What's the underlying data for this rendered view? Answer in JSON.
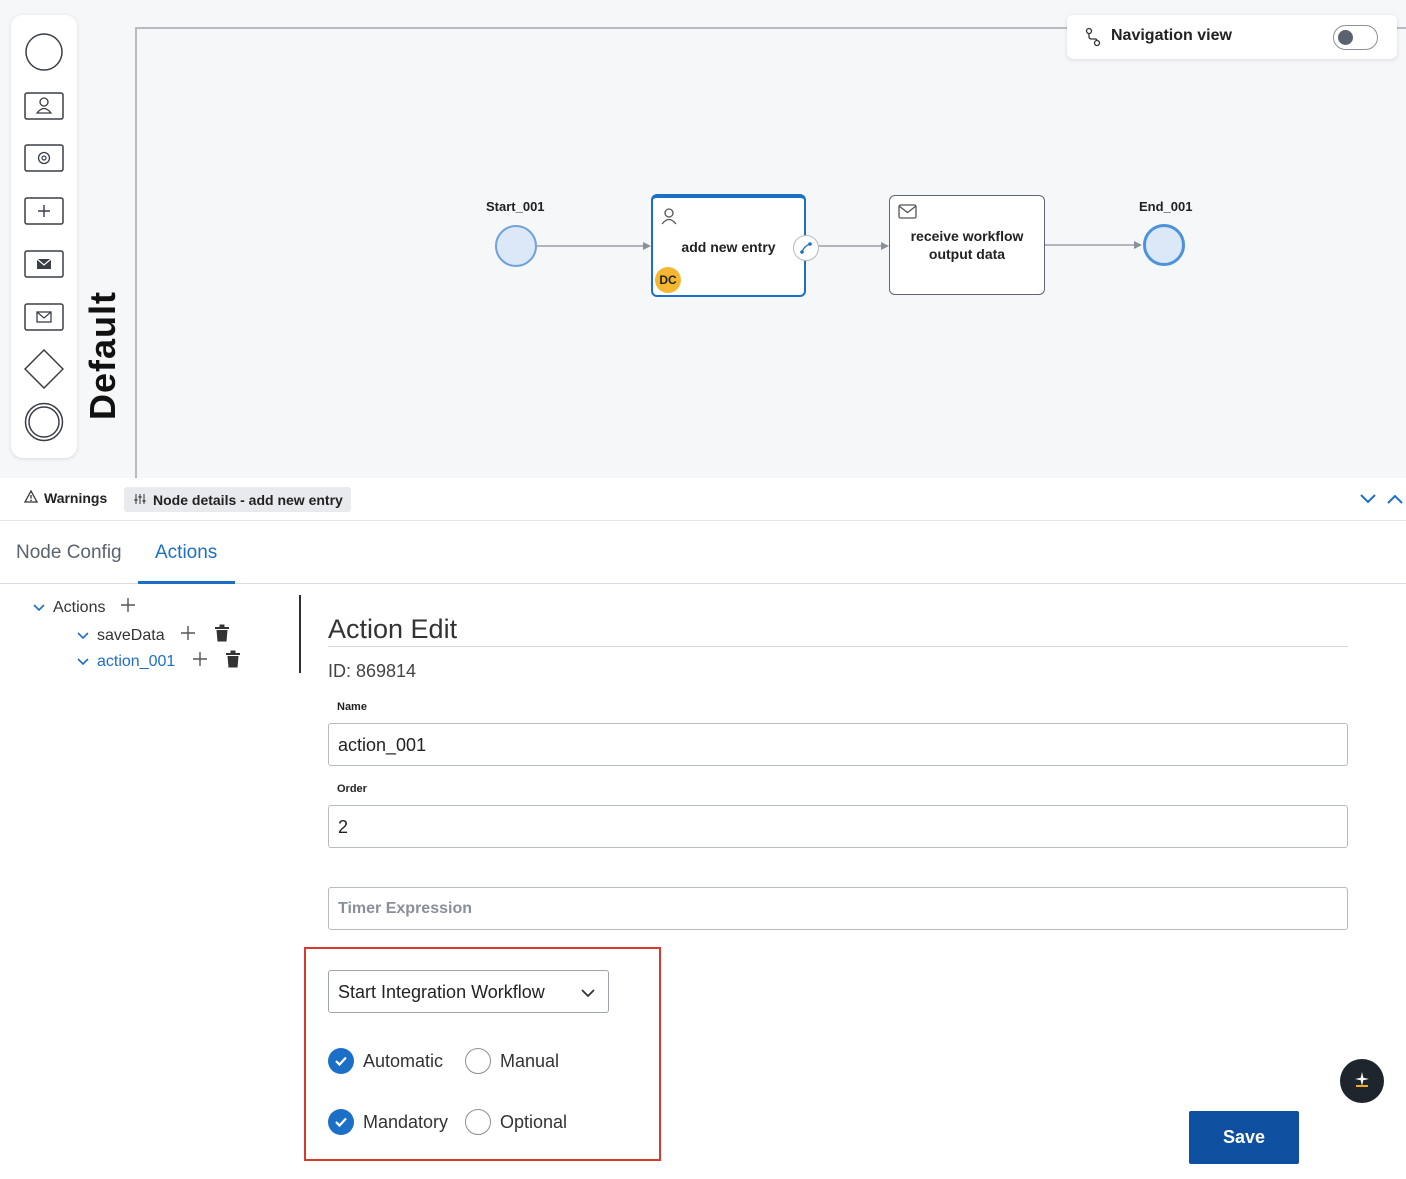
{
  "canvas": {
    "pool_label": "Default",
    "navigation_view": {
      "label": "Navigation view",
      "enabled": false
    },
    "nodes": {
      "start": {
        "label": "Start_001"
      },
      "task1": {
        "label": "add new entry",
        "badge": "DC"
      },
      "task2": {
        "line1": "receive workflow",
        "line2": "output data"
      },
      "end": {
        "label": "End_001"
      }
    },
    "palette": [
      "start-event-icon",
      "user-task-icon",
      "service-task-icon",
      "subprocess-icon",
      "send-message-icon",
      "receive-message-icon",
      "gateway-icon",
      "end-event-icon"
    ]
  },
  "bottom_bar": {
    "warnings": "Warnings",
    "node_details": "Node details - add new entry"
  },
  "tabs": [
    {
      "label": "Node Config",
      "active": false
    },
    {
      "label": "Actions",
      "active": true
    }
  ],
  "tree": {
    "root": "Actions",
    "items": [
      {
        "label": "saveData",
        "selected": false
      },
      {
        "label": "action_001",
        "selected": true
      }
    ]
  },
  "editor": {
    "title": "Action Edit",
    "id_text": "ID: 869814",
    "name_label": "Name",
    "name_value": "action_001",
    "order_label": "Order",
    "order_value": "2",
    "timer_placeholder": "Timer Expression",
    "action_type": "Start Integration Workflow",
    "trigger": {
      "automatic": "Automatic",
      "manual": "Manual",
      "selected": "Automatic"
    },
    "requirement": {
      "mandatory": "Mandatory",
      "optional": "Optional",
      "selected": "Mandatory"
    },
    "save_label": "Save"
  },
  "colors": {
    "accent": "#1c6fc7",
    "save": "#0f4fa0",
    "highlight": "#d93a2b",
    "badge": "#f5b731"
  }
}
